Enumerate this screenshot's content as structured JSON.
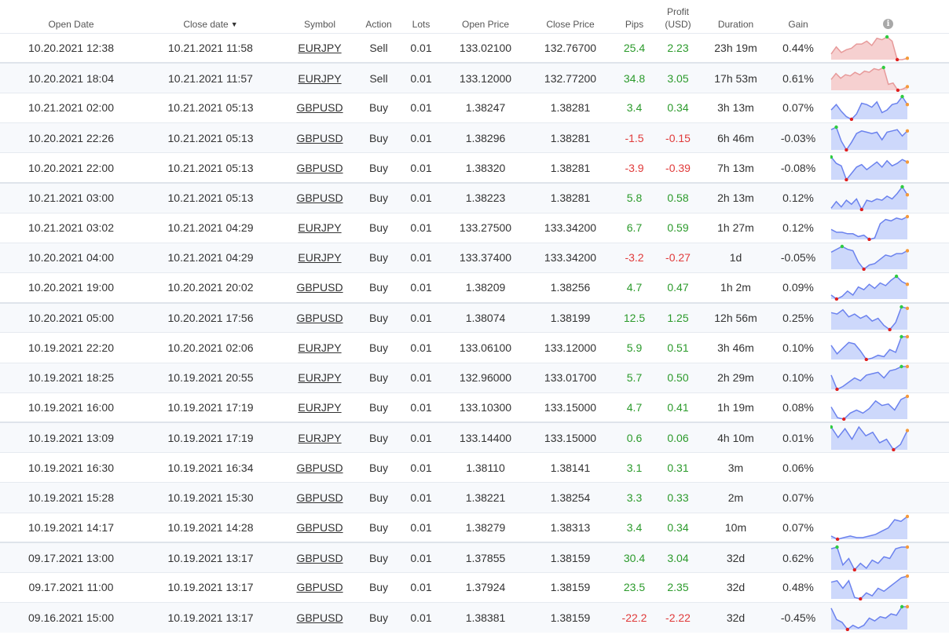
{
  "headers": {
    "open_date": "Open Date",
    "close_date": "Close date",
    "sort_arrow": "▼",
    "symbol": "Symbol",
    "action": "Action",
    "lots": "Lots",
    "open_price": "Open Price",
    "close_price": "Close Price",
    "pips": "Pips",
    "profit_line1": "Profit",
    "profit_line2": "(USD)",
    "duration": "Duration",
    "gain": "Gain",
    "info_glyph": "i"
  },
  "colors": {
    "positive": "#2b9a2b",
    "negative": "#e03a3a",
    "chart_blue_fill": "#cdd8fb",
    "chart_blue_line": "#6b82ee",
    "chart_red_fill": "#f6d0d0",
    "chart_red_line": "#e79a9a",
    "marker_high": "#2ecc40",
    "marker_low": "#e02020",
    "marker_end": "#f59a3a"
  },
  "trades": [
    {
      "open_date": "10.20.2021 12:38",
      "close_date": "10.21.2021 11:58",
      "symbol": "EURJPY",
      "action": "Sell",
      "lots": "0.01",
      "open_price": "133.02100",
      "close_price": "132.76700",
      "pips": "25.4",
      "profit": "2.23",
      "duration": "23h 19m",
      "gain": "0.44%",
      "sentiment": "pos",
      "spark": {
        "color": "red",
        "values": [
          5,
          10,
          6,
          8,
          9,
          12,
          12,
          14,
          11,
          16,
          15,
          17,
          14,
          1,
          1,
          2
        ]
      }
    },
    {
      "open_date": "10.20.2021 18:04",
      "close_date": "10.21.2021 11:57",
      "symbol": "EURJPY",
      "action": "Sell",
      "lots": "0.01",
      "open_price": "133.12000",
      "close_price": "132.77200",
      "pips": "34.8",
      "profit": "3.05",
      "duration": "17h 53m",
      "gain": "0.61%",
      "sentiment": "pos",
      "spark": {
        "color": "red",
        "values": [
          10,
          15,
          11,
          14,
          13,
          16,
          14,
          17,
          16,
          19,
          18,
          20,
          6,
          7,
          1,
          2,
          4
        ]
      }
    },
    {
      "open_date": "10.21.2021 02:00",
      "close_date": "10.21.2021 05:13",
      "symbol": "GBPUSD",
      "action": "Buy",
      "lots": "0.01",
      "open_price": "1.38247",
      "close_price": "1.38281",
      "pips": "3.4",
      "profit": "0.34",
      "duration": "3h 13m",
      "gain": "0.07%",
      "sentiment": "pos",
      "spark": {
        "color": "blue",
        "values": [
          8,
          12,
          7,
          3,
          1,
          5,
          13,
          12,
          10,
          14,
          6,
          8,
          12,
          13,
          18,
          12
        ]
      }
    },
    {
      "open_date": "10.20.2021 22:26",
      "close_date": "10.21.2021 05:13",
      "symbol": "GBPUSD",
      "action": "Buy",
      "lots": "0.01",
      "open_price": "1.38296",
      "close_price": "1.38281",
      "pips": "-1.5",
      "profit": "-0.15",
      "duration": "6h 46m",
      "gain": "-0.03%",
      "sentiment": "neg",
      "spark": {
        "color": "blue",
        "values": [
          17,
          19,
          8,
          1,
          7,
          14,
          16,
          15,
          14,
          15,
          9,
          15,
          16,
          17,
          12,
          16
        ]
      }
    },
    {
      "open_date": "10.20.2021 22:00",
      "close_date": "10.21.2021 05:13",
      "symbol": "GBPUSD",
      "action": "Buy",
      "lots": "0.01",
      "open_price": "1.38320",
      "close_price": "1.38281",
      "pips": "-3.9",
      "profit": "-0.39",
      "duration": "7h 13m",
      "gain": "-0.08%",
      "sentiment": "neg",
      "spark": {
        "color": "blue",
        "values": [
          19,
          14,
          12,
          1,
          6,
          11,
          13,
          9,
          12,
          15,
          11,
          16,
          12,
          14,
          17,
          15
        ]
      }
    },
    {
      "open_date": "10.21.2021 03:00",
      "close_date": "10.21.2021 05:13",
      "symbol": "GBPUSD",
      "action": "Buy",
      "lots": "0.01",
      "open_price": "1.38223",
      "close_price": "1.38281",
      "pips": "5.8",
      "profit": "0.58",
      "duration": "2h 13m",
      "gain": "0.12%",
      "sentiment": "pos",
      "spark": {
        "color": "blue",
        "values": [
          3,
          8,
          4,
          9,
          6,
          10,
          2,
          9,
          8,
          10,
          9,
          12,
          10,
          14,
          19,
          13
        ]
      }
    },
    {
      "open_date": "10.21.2021 03:02",
      "close_date": "10.21.2021 04:29",
      "symbol": "EURJPY",
      "action": "Buy",
      "lots": "0.01",
      "open_price": "133.27500",
      "close_price": "133.34200",
      "pips": "6.7",
      "profit": "0.59",
      "duration": "1h 27m",
      "gain": "0.12%",
      "sentiment": "pos",
      "spark": {
        "color": "blue",
        "values": [
          8,
          6,
          6,
          5,
          5,
          3,
          4,
          1,
          2,
          12,
          15,
          14,
          16,
          15,
          17
        ]
      }
    },
    {
      "open_date": "10.20.2021 04:00",
      "close_date": "10.21.2021 04:29",
      "symbol": "EURJPY",
      "action": "Buy",
      "lots": "0.01",
      "open_price": "133.37400",
      "close_price": "133.34200",
      "pips": "-3.2",
      "profit": "-0.27",
      "duration": "1d",
      "gain": "-0.05%",
      "sentiment": "neg",
      "spark": {
        "color": "blue",
        "values": [
          13,
          15,
          17,
          15,
          14,
          6,
          1,
          4,
          5,
          8,
          11,
          10,
          12,
          12,
          14
        ]
      }
    },
    {
      "open_date": "10.20.2021 19:00",
      "close_date": "10.20.2021 20:02",
      "symbol": "GBPUSD",
      "action": "Buy",
      "lots": "0.01",
      "open_price": "1.38209",
      "close_price": "1.38256",
      "pips": "4.7",
      "profit": "0.47",
      "duration": "1h 2m",
      "gain": "0.09%",
      "sentiment": "pos",
      "spark": {
        "color": "blue",
        "values": [
          5,
          2,
          4,
          8,
          5,
          11,
          9,
          13,
          10,
          14,
          12,
          16,
          19,
          15,
          13
        ]
      }
    },
    {
      "open_date": "10.20.2021 05:00",
      "close_date": "10.20.2021 17:56",
      "symbol": "GBPUSD",
      "action": "Buy",
      "lots": "0.01",
      "open_price": "1.38074",
      "close_price": "1.38199",
      "pips": "12.5",
      "profit": "1.25",
      "duration": "12h 56m",
      "gain": "0.25%",
      "sentiment": "pos",
      "spark": {
        "color": "blue",
        "values": [
          13,
          12,
          15,
          10,
          12,
          9,
          11,
          7,
          9,
          4,
          1,
          6,
          17,
          16
        ]
      }
    },
    {
      "open_date": "10.19.2021 22:20",
      "close_date": "10.20.2021 02:06",
      "symbol": "EURJPY",
      "action": "Buy",
      "lots": "0.01",
      "open_price": "133.06100",
      "close_price": "133.12000",
      "pips": "5.9",
      "profit": "0.51",
      "duration": "3h 46m",
      "gain": "0.10%",
      "sentiment": "pos",
      "spark": {
        "color": "blue",
        "values": [
          12,
          6,
          10,
          14,
          13,
          8,
          2,
          3,
          5,
          4,
          9,
          7,
          18,
          18
        ]
      }
    },
    {
      "open_date": "10.19.2021 18:25",
      "close_date": "10.19.2021 20:55",
      "symbol": "EURJPY",
      "action": "Buy",
      "lots": "0.01",
      "open_price": "132.96000",
      "close_price": "133.01700",
      "pips": "5.7",
      "profit": "0.50",
      "duration": "2h 29m",
      "gain": "0.10%",
      "sentiment": "pos",
      "spark": {
        "color": "blue",
        "values": [
          12,
          2,
          4,
          7,
          10,
          8,
          12,
          13,
          14,
          10,
          15,
          16,
          18,
          18
        ]
      }
    },
    {
      "open_date": "10.19.2021 16:00",
      "close_date": "10.19.2021 17:19",
      "symbol": "EURJPY",
      "action": "Buy",
      "lots": "0.01",
      "open_price": "133.10300",
      "close_price": "133.15000",
      "pips": "4.7",
      "profit": "0.41",
      "duration": "1h 19m",
      "gain": "0.08%",
      "sentiment": "pos",
      "spark": {
        "color": "blue",
        "values": [
          10,
          3,
          2,
          6,
          8,
          6,
          9,
          14,
          11,
          12,
          8,
          15,
          17
        ]
      }
    },
    {
      "open_date": "10.19.2021 13:09",
      "close_date": "10.19.2021 17:19",
      "symbol": "EURJPY",
      "action": "Buy",
      "lots": "0.01",
      "open_price": "133.14400",
      "close_price": "133.15000",
      "pips": "0.6",
      "profit": "0.06",
      "duration": "4h 10m",
      "gain": "0.01%",
      "sentiment": "pos",
      "spark": {
        "color": "blue",
        "values": [
          16,
          10,
          15,
          9,
          16,
          11,
          13,
          7,
          9,
          3,
          6,
          14
        ]
      }
    },
    {
      "open_date": "10.19.2021 16:30",
      "close_date": "10.19.2021 16:34",
      "symbol": "GBPUSD",
      "action": "Buy",
      "lots": "0.01",
      "open_price": "1.38110",
      "close_price": "1.38141",
      "pips": "3.1",
      "profit": "0.31",
      "duration": "3m",
      "gain": "0.06%",
      "sentiment": "pos",
      "spark": null
    },
    {
      "open_date": "10.19.2021 15:28",
      "close_date": "10.19.2021 15:30",
      "symbol": "GBPUSD",
      "action": "Buy",
      "lots": "0.01",
      "open_price": "1.38221",
      "close_price": "1.38254",
      "pips": "3.3",
      "profit": "0.33",
      "duration": "2m",
      "gain": "0.07%",
      "sentiment": "pos",
      "spark": null
    },
    {
      "open_date": "10.19.2021 14:17",
      "close_date": "10.19.2021 14:28",
      "symbol": "GBPUSD",
      "action": "Buy",
      "lots": "0.01",
      "open_price": "1.38279",
      "close_price": "1.38313",
      "pips": "3.4",
      "profit": "0.34",
      "duration": "10m",
      "gain": "0.07%",
      "sentiment": "pos",
      "spark": {
        "color": "blue",
        "values": [
          3,
          1,
          2,
          3,
          2,
          2,
          3,
          4,
          6,
          8,
          13,
          12,
          15
        ]
      }
    },
    {
      "open_date": "09.17.2021 13:00",
      "close_date": "10.19.2021 13:17",
      "symbol": "GBPUSD",
      "action": "Buy",
      "lots": "0.01",
      "open_price": "1.37855",
      "close_price": "1.38159",
      "pips": "30.4",
      "profit": "3.04",
      "duration": "32d",
      "gain": "0.62%",
      "sentiment": "pos",
      "spark": {
        "color": "blue",
        "values": [
          14,
          15,
          4,
          8,
          1,
          5,
          2,
          7,
          5,
          9,
          8,
          14,
          15,
          15
        ]
      }
    },
    {
      "open_date": "09.17.2021 11:00",
      "close_date": "10.19.2021 13:17",
      "symbol": "GBPUSD",
      "action": "Buy",
      "lots": "0.01",
      "open_price": "1.37924",
      "close_price": "1.38159",
      "pips": "23.5",
      "profit": "2.35",
      "duration": "32d",
      "gain": "0.48%",
      "sentiment": "pos",
      "spark": {
        "color": "blue",
        "values": [
          12,
          13,
          8,
          13,
          2,
          1,
          5,
          3,
          8,
          6,
          9,
          12,
          15,
          16
        ]
      }
    },
    {
      "open_date": "09.16.2021 15:00",
      "close_date": "10.19.2021 13:17",
      "symbol": "GBPUSD",
      "action": "Buy",
      "lots": "0.01",
      "open_price": "1.38381",
      "close_price": "1.38159",
      "pips": "-22.2",
      "profit": "-2.22",
      "duration": "32d",
      "gain": "-0.45%",
      "sentiment": "neg",
      "spark": {
        "color": "blue",
        "values": [
          16,
          8,
          6,
          1,
          4,
          2,
          4,
          9,
          7,
          10,
          9,
          12,
          11,
          17,
          17
        ]
      }
    }
  ]
}
